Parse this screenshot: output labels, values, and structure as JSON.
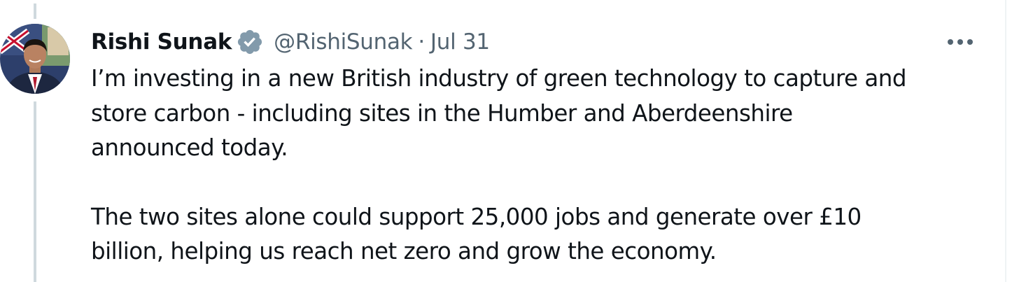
{
  "tweet": {
    "author": {
      "display_name": "Rishi Sunak",
      "handle": "@RishiSunak",
      "verified_icon": "verified-badge-icon",
      "avatar": "profile-photo"
    },
    "separator": "·",
    "date": "Jul 31",
    "more_icon": "more-dots-icon",
    "text_lines": [
      "I’m investing in a new British industry of green technology to capture and",
      "store carbon - including sites in the Humber and Aberdeenshire",
      "announced today.",
      "The two sites alone could support 25,000 jobs and generate over £10",
      "billion, helping us reach net zero and grow the economy."
    ]
  },
  "colors": {
    "text_primary": "#0f1419",
    "text_secondary": "#536471",
    "thread_line": "#cfd9de",
    "verified_badge": "#829aab"
  }
}
